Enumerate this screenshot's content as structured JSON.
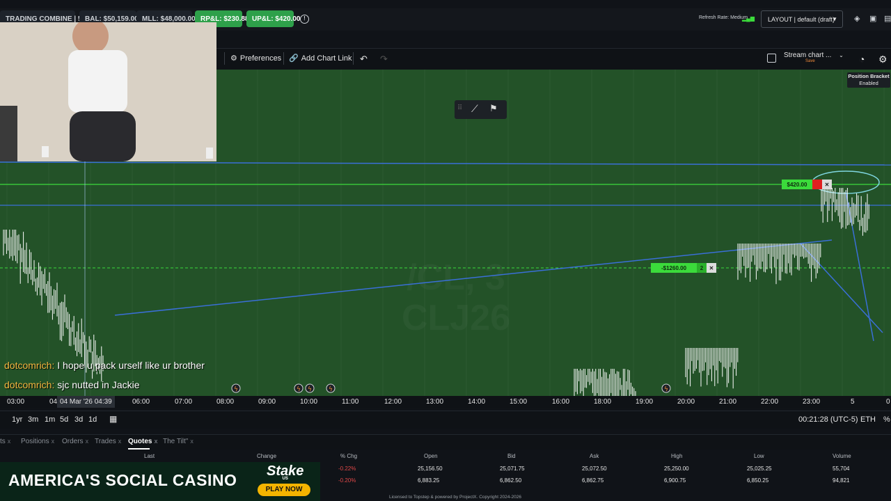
{
  "topbar": {
    "account_label": "TRADING COMBINE | 5...",
    "bal_label": "BAL: $50,159.00",
    "mll_label": "MLL: $48,000.00",
    "rpnl_label": "RP&L: $230.88",
    "upnl_label": "UP&L: $420.00",
    "refresh_rate": "Refresh Rate: Medium",
    "layout_label": "LAYOUT | default (draft)"
  },
  "toolbar": {
    "preferences_label": "Preferences",
    "add_chart_link_label": "Add Chart Link",
    "stream_chart_label": "Stream chart ...",
    "stream_save_label": "Save",
    "position_bracket_title": "Position Bracket",
    "position_bracket_status": "Enabled"
  },
  "chart": {
    "order_tp_label": "$420.00",
    "order_sl_label": "-$1260.00",
    "order_sl_qty": "2",
    "watermark_line1": "/CL, 3",
    "watermark_line2": "CLJ26",
    "cursor_time": "04 Mar '26  04:39",
    "time_ticks": [
      "03:00",
      "04",
      "06:00",
      "07:00",
      "08:00",
      "09:00",
      "10:00",
      "11:00",
      "12:00",
      "13:00",
      "14:00",
      "15:00",
      "16:00",
      "18:00",
      "19:00",
      "20:00",
      "21:00",
      "22:00",
      "23:00",
      "5",
      "0"
    ]
  },
  "chat": [
    {
      "user": "dotcomrich:",
      "message": " I hope u pack urself like ur brother"
    },
    {
      "user": "dotcomrich:",
      "message": " sjc nutted in Jackie"
    }
  ],
  "range_buttons": [
    "1yr",
    "3m",
    "1m",
    "5d",
    "3d",
    "1d"
  ],
  "status": {
    "clock": "00:21:28 (UTC-5)",
    "session": "ETH",
    "pct": "%"
  },
  "bottom_tabs": [
    {
      "label": "ts"
    },
    {
      "label": "Positions"
    },
    {
      "label": "Orders"
    },
    {
      "label": "Trades"
    },
    {
      "label": "Quotes"
    },
    {
      "label": "The Tilt\""
    }
  ],
  "quotes": {
    "headers": [
      "Last",
      "Change",
      "% Chg",
      "Open",
      "Bid",
      "Ask",
      "High",
      "Low",
      "Volume"
    ],
    "rows": [
      {
        "pct": "-0.22%",
        "open": "25,156.50",
        "bid": "25,071.75",
        "ask": "25,072.50",
        "high": "25,250.00",
        "low": "25,025.25",
        "volume": "55,704"
      },
      {
        "pct": "-0.20%",
        "open": "6,883.25",
        "bid": "6,862.50",
        "ask": "6,862.75",
        "high": "6,900.75",
        "low": "6,850.25",
        "volume": "94,821"
      }
    ]
  },
  "ad": {
    "headline": "AMERICA'S SOCIAL CASINO",
    "brand": "Stake",
    "brand_sub": "US",
    "cta": "PLAY NOW"
  },
  "footer": {
    "license": "Licensed to Topstep & powered by ProjectX. Copyright 2024-2026"
  },
  "colors": {
    "chart_bg": "#235228",
    "accent_green": "#2ea04a",
    "trend_line": "#3a6fd8",
    "order_tag": "#3bdb3b",
    "negative": "#e04848",
    "chat_user": "#f4b841"
  }
}
